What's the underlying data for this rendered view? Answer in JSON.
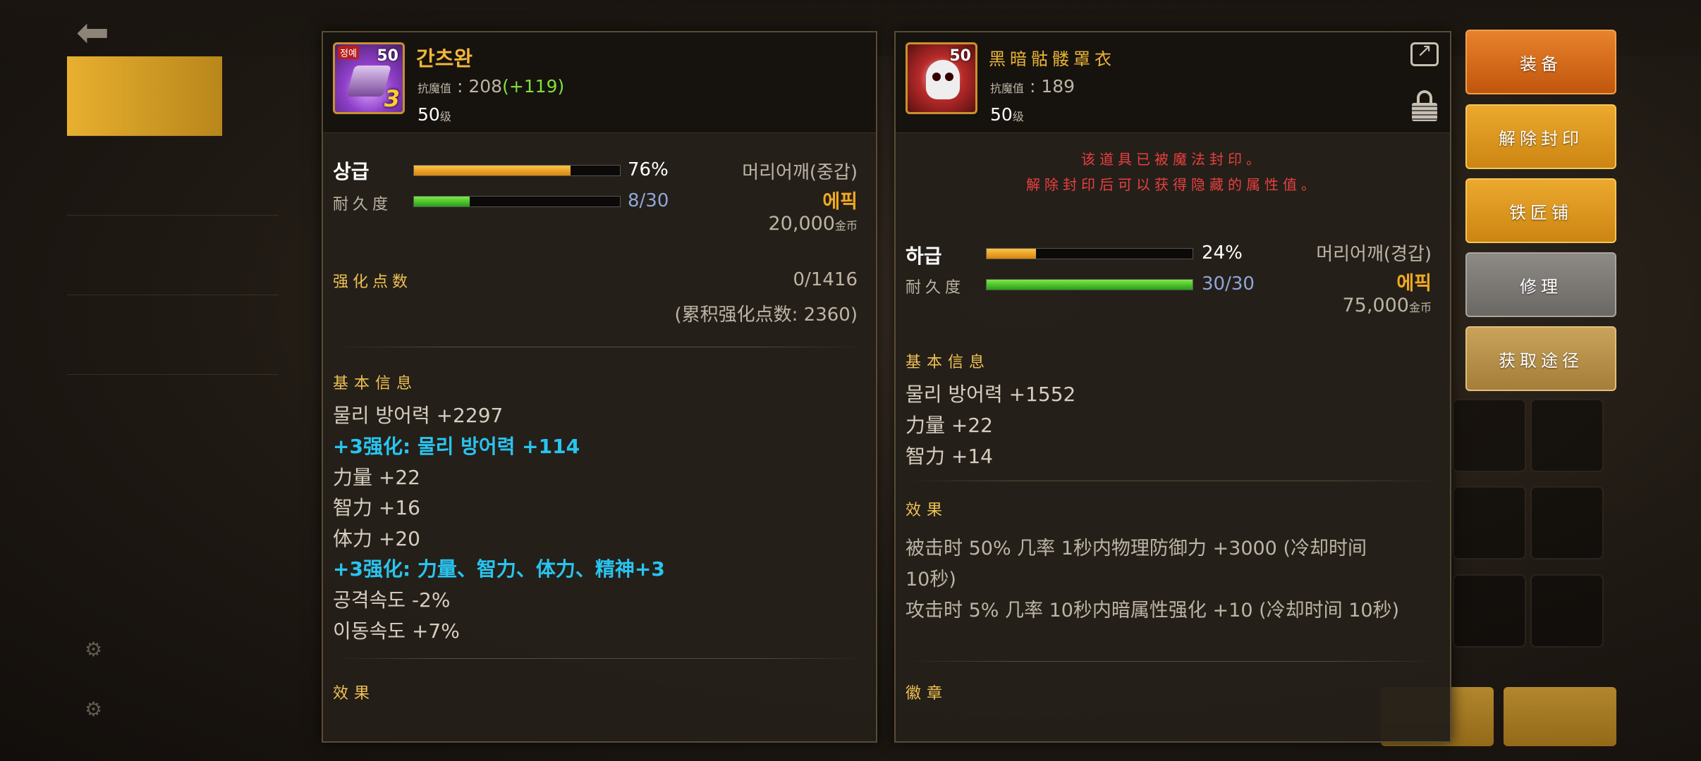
{
  "colors": {
    "accent_gold": "#f0a920",
    "enhance_cyan": "#29c4f0",
    "bonus_green": "#7fe03c",
    "warning_red": "#e84040"
  },
  "left": {
    "name": "간츠완",
    "icon_level": "50",
    "icon_grade": "정예",
    "icon_enh": "3",
    "stat_label": "抗魔值",
    "stat_value": ": 208",
    "stat_bonus": "(+119)",
    "level": "50",
    "level_suffix": "级",
    "grade": "상급",
    "grade_pct": "76%",
    "grade_fill": 0.76,
    "durability_label": "耐久度",
    "durability": "8/30",
    "durability_fill": 0.27,
    "type": "머리어깨(중갑)",
    "rarity": "에픽",
    "price": "20,000",
    "price_suffix": "金币",
    "enhance_label": "强化点数",
    "enhance_points": "0/1416",
    "enhance_total": "(累积强化点数: 2360)",
    "basic_title": "基本信息",
    "stats": [
      "물리 방어력 +2297",
      "+3强化: 물리 방어력 +114",
      "力量 +22",
      "智力 +16",
      "体力 +20",
      "+3强化: 力量、智力、体力、精神+3",
      "공격속도 -2%",
      "이동속도 +7%"
    ],
    "effect_title": "效果"
  },
  "right": {
    "name": "黑暗骷髅罩衣",
    "icon_level": "50",
    "stat_label": "抗魔值",
    "stat_value": ": 189",
    "level": "50",
    "level_suffix": "级",
    "warning1": "该道具已被魔法封印。",
    "warning2": "解除封印后可以获得隐藏的属性值。",
    "grade": "하급",
    "grade_pct": "24%",
    "grade_fill": 0.24,
    "durability_label": "耐久度",
    "durability": "30/30",
    "durability_fill": 1.0,
    "type": "머리어깨(경갑)",
    "rarity": "에픽",
    "price": "75,000",
    "price_suffix": "金币",
    "basic_title": "基本信息",
    "stats": [
      "물리 방어력 +1552",
      "力量 +22",
      "智力 +14"
    ],
    "effect_title": "效果",
    "effects": [
      "被击时 50% 几率 1秒内物理防御力 +3000 (冷却时间",
      "10秒)",
      "攻击时 5% 几率 10秒内暗属性强化 +10 (冷却时间 10秒)"
    ],
    "emblem_title": "徽章"
  },
  "buttons": {
    "equip": "装备",
    "unseal": "解除封印",
    "smith": "铁匠铺",
    "repair": "修理",
    "source": "获取途径"
  }
}
